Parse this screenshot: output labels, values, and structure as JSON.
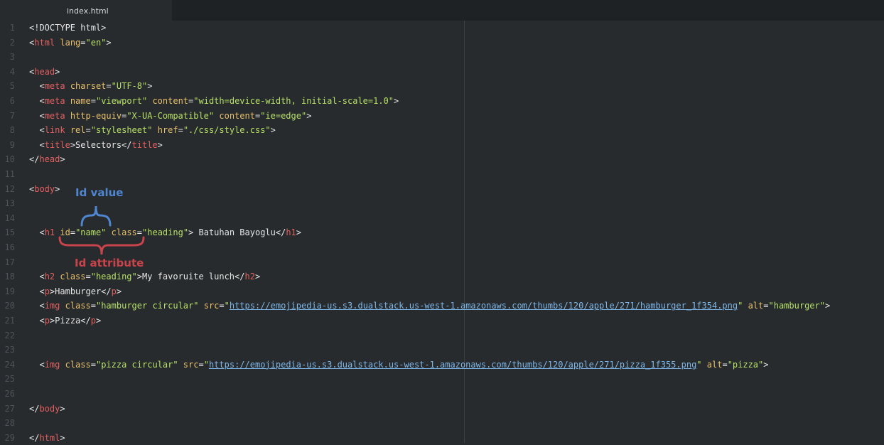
{
  "tab": {
    "label": "index.html"
  },
  "lines": [
    {
      "n": "1",
      "segs": [
        [
          "tx",
          "<!DOCTYPE html>"
        ]
      ]
    },
    {
      "n": "2",
      "segs": [
        [
          "tx",
          "<"
        ],
        [
          "tg",
          "html"
        ],
        [
          "tx",
          " "
        ],
        [
          "at",
          "lang"
        ],
        [
          "tx",
          "="
        ],
        [
          "st",
          "\"en\""
        ],
        [
          "tx",
          ">"
        ]
      ]
    },
    {
      "n": "3",
      "segs": []
    },
    {
      "n": "4",
      "segs": [
        [
          "tx",
          "<"
        ],
        [
          "tg",
          "head"
        ],
        [
          "tx",
          ">"
        ]
      ]
    },
    {
      "n": "5",
      "segs": [
        [
          "tx",
          "  <"
        ],
        [
          "tg",
          "meta"
        ],
        [
          "tx",
          " "
        ],
        [
          "at",
          "charset"
        ],
        [
          "tx",
          "="
        ],
        [
          "st",
          "\"UTF-8\""
        ],
        [
          "tx",
          ">"
        ]
      ]
    },
    {
      "n": "6",
      "segs": [
        [
          "tx",
          "  <"
        ],
        [
          "tg",
          "meta"
        ],
        [
          "tx",
          " "
        ],
        [
          "at",
          "name"
        ],
        [
          "tx",
          "="
        ],
        [
          "st",
          "\"viewport\""
        ],
        [
          "tx",
          " "
        ],
        [
          "at",
          "content"
        ],
        [
          "tx",
          "="
        ],
        [
          "st",
          "\"width=device-width, initial-scale=1.0\""
        ],
        [
          "tx",
          ">"
        ]
      ]
    },
    {
      "n": "7",
      "segs": [
        [
          "tx",
          "  <"
        ],
        [
          "tg",
          "meta"
        ],
        [
          "tx",
          " "
        ],
        [
          "at",
          "http-equiv"
        ],
        [
          "tx",
          "="
        ],
        [
          "st",
          "\"X-UA-Compatible\""
        ],
        [
          "tx",
          " "
        ],
        [
          "at",
          "content"
        ],
        [
          "tx",
          "="
        ],
        [
          "st",
          "\"ie=edge\""
        ],
        [
          "tx",
          ">"
        ]
      ]
    },
    {
      "n": "8",
      "segs": [
        [
          "tx",
          "  <"
        ],
        [
          "tg",
          "link"
        ],
        [
          "tx",
          " "
        ],
        [
          "at",
          "rel"
        ],
        [
          "tx",
          "="
        ],
        [
          "st",
          "\"stylesheet\""
        ],
        [
          "tx",
          " "
        ],
        [
          "at",
          "href"
        ],
        [
          "tx",
          "="
        ],
        [
          "st",
          "\"./css/style.css\""
        ],
        [
          "tx",
          ">"
        ]
      ]
    },
    {
      "n": "9",
      "segs": [
        [
          "tx",
          "  <"
        ],
        [
          "tg",
          "title"
        ],
        [
          "tx",
          ">Selectors</"
        ],
        [
          "tg",
          "title"
        ],
        [
          "tx",
          ">"
        ]
      ]
    },
    {
      "n": "10",
      "segs": [
        [
          "tx",
          "</"
        ],
        [
          "tg",
          "head"
        ],
        [
          "tx",
          ">"
        ]
      ]
    },
    {
      "n": "11",
      "segs": []
    },
    {
      "n": "12",
      "segs": [
        [
          "tx",
          "<"
        ],
        [
          "tg",
          "body"
        ],
        [
          "tx",
          ">"
        ]
      ]
    },
    {
      "n": "13",
      "segs": []
    },
    {
      "n": "14",
      "segs": []
    },
    {
      "n": "15",
      "segs": [
        [
          "tx",
          "  <"
        ],
        [
          "tg",
          "h1"
        ],
        [
          "tx",
          " "
        ],
        [
          "at",
          "id"
        ],
        [
          "tx",
          "="
        ],
        [
          "st",
          "\"name\""
        ],
        [
          "tx",
          " "
        ],
        [
          "at",
          "class"
        ],
        [
          "tx",
          "="
        ],
        [
          "st",
          "\"heading\""
        ],
        [
          "tx",
          "> Batuhan Bayoglu</"
        ],
        [
          "tg",
          "h1"
        ],
        [
          "tx",
          ">"
        ]
      ]
    },
    {
      "n": "16",
      "segs": []
    },
    {
      "n": "17",
      "segs": []
    },
    {
      "n": "18",
      "segs": [
        [
          "tx",
          "  <"
        ],
        [
          "tg",
          "h2"
        ],
        [
          "tx",
          " "
        ],
        [
          "at",
          "class"
        ],
        [
          "tx",
          "="
        ],
        [
          "st",
          "\"heading\""
        ],
        [
          "tx",
          ">My favoruite lunch</"
        ],
        [
          "tg",
          "h2"
        ],
        [
          "tx",
          ">"
        ]
      ]
    },
    {
      "n": "19",
      "segs": [
        [
          "tx",
          "  <"
        ],
        [
          "tg",
          "p"
        ],
        [
          "tx",
          ">Hamburger</"
        ],
        [
          "tg",
          "p"
        ],
        [
          "tx",
          ">"
        ]
      ]
    },
    {
      "n": "20",
      "segs": [
        [
          "tx",
          "  <"
        ],
        [
          "tg",
          "img"
        ],
        [
          "tx",
          " "
        ],
        [
          "at",
          "class"
        ],
        [
          "tx",
          "="
        ],
        [
          "st",
          "\"hamburger circular\""
        ],
        [
          "tx",
          " "
        ],
        [
          "at",
          "src"
        ],
        [
          "tx",
          "="
        ],
        [
          "st",
          "\""
        ],
        [
          "lk",
          "https://emojipedia-us.s3.dualstack.us-west-1.amazonaws.com/thumbs/120/apple/271/hamburger_1f354.png"
        ],
        [
          "st",
          "\""
        ],
        [
          "tx",
          " "
        ],
        [
          "at",
          "alt"
        ],
        [
          "tx",
          "="
        ],
        [
          "st",
          "\"hamburger\""
        ],
        [
          "tx",
          ">"
        ]
      ]
    },
    {
      "n": "21",
      "segs": [
        [
          "tx",
          "  <"
        ],
        [
          "tg",
          "p"
        ],
        [
          "tx",
          ">Pizza</"
        ],
        [
          "tg",
          "p"
        ],
        [
          "tx",
          ">"
        ]
      ]
    },
    {
      "n": "22",
      "segs": []
    },
    {
      "n": "23",
      "segs": []
    },
    {
      "n": "24",
      "segs": [
        [
          "tx",
          "  <"
        ],
        [
          "tg",
          "img"
        ],
        [
          "tx",
          " "
        ],
        [
          "at",
          "class"
        ],
        [
          "tx",
          "="
        ],
        [
          "st",
          "\"pizza circular\""
        ],
        [
          "tx",
          " "
        ],
        [
          "at",
          "src"
        ],
        [
          "tx",
          "="
        ],
        [
          "st",
          "\""
        ],
        [
          "lk",
          "https://emojipedia-us.s3.dualstack.us-west-1.amazonaws.com/thumbs/120/apple/271/pizza_1f355.png"
        ],
        [
          "st",
          "\""
        ],
        [
          "tx",
          " "
        ],
        [
          "at",
          "alt"
        ],
        [
          "tx",
          "="
        ],
        [
          "st",
          "\"pizza\""
        ],
        [
          "tx",
          ">"
        ]
      ]
    },
    {
      "n": "25",
      "segs": []
    },
    {
      "n": "26",
      "segs": []
    },
    {
      "n": "27",
      "segs": [
        [
          "tx",
          "</"
        ],
        [
          "tg",
          "body"
        ],
        [
          "tx",
          ">"
        ]
      ]
    },
    {
      "n": "28",
      "segs": []
    },
    {
      "n": "29",
      "segs": [
        [
          "tx",
          "</"
        ],
        [
          "tg",
          "html"
        ],
        [
          "tx",
          ">"
        ]
      ]
    }
  ],
  "annotations": {
    "id_value": "Id value",
    "id_attribute": "Id attribute"
  },
  "colors": {
    "background": "#272b2e",
    "tag": "#e35f5f",
    "attribute": "#e8c06a",
    "string": "#b7e067",
    "link": "#7fb6e6",
    "annotation_value": "#4f86cf",
    "annotation_attribute": "#c9434a"
  }
}
